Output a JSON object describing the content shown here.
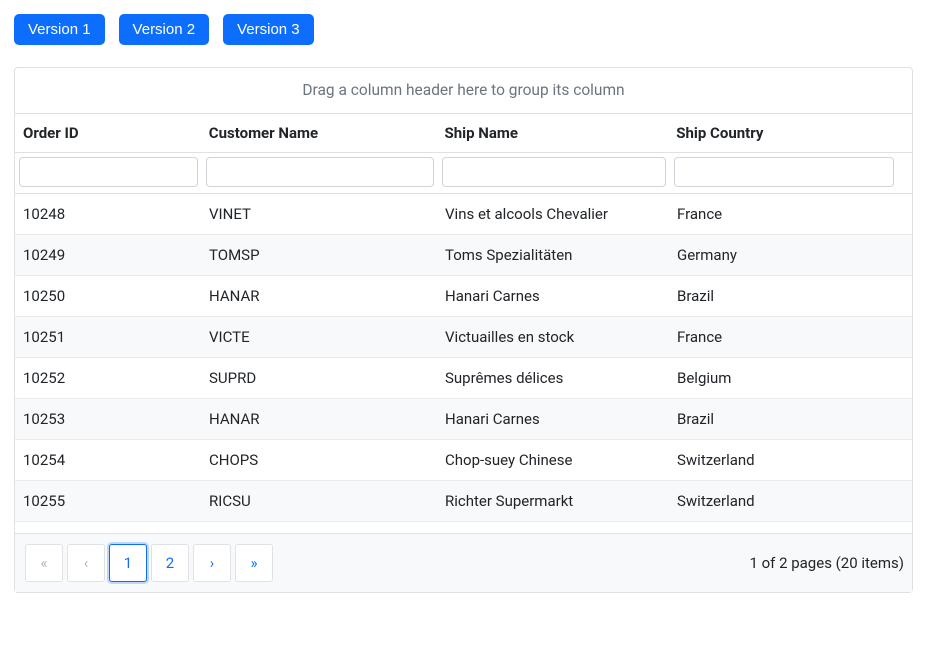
{
  "buttons": {
    "v1": "Version 1",
    "v2": "Version 2",
    "v3": "Version 3"
  },
  "grid": {
    "groupHint": "Drag a column header here to group its column",
    "columns": [
      {
        "label": "Order ID",
        "field": "orderId"
      },
      {
        "label": "Customer Name",
        "field": "customerName"
      },
      {
        "label": "Ship Name",
        "field": "shipName"
      },
      {
        "label": "Ship Country",
        "field": "shipCountry"
      }
    ],
    "filters": [
      "",
      "",
      "",
      ""
    ],
    "rows": [
      {
        "orderId": "10248",
        "customerName": "VINET",
        "shipName": "Vins et alcools Chevalier",
        "shipCountry": "France"
      },
      {
        "orderId": "10249",
        "customerName": "TOMSP",
        "shipName": "Toms Spezialitäten",
        "shipCountry": "Germany"
      },
      {
        "orderId": "10250",
        "customerName": "HANAR",
        "shipName": "Hanari Carnes",
        "shipCountry": "Brazil"
      },
      {
        "orderId": "10251",
        "customerName": "VICTE",
        "shipName": "Victuailles en stock",
        "shipCountry": "France"
      },
      {
        "orderId": "10252",
        "customerName": "SUPRD",
        "shipName": "Suprêmes délices",
        "shipCountry": "Belgium"
      },
      {
        "orderId": "10253",
        "customerName": "HANAR",
        "shipName": "Hanari Carnes",
        "shipCountry": "Brazil"
      },
      {
        "orderId": "10254",
        "customerName": "CHOPS",
        "shipName": "Chop-suey Chinese",
        "shipCountry": "Switzerland"
      },
      {
        "orderId": "10255",
        "customerName": "RICSU",
        "shipName": "Richter Supermarkt",
        "shipCountry": "Switzerland"
      }
    ]
  },
  "pager": {
    "first": "«",
    "prev": "‹",
    "next": "›",
    "last": "»",
    "pages": [
      "1",
      "2"
    ],
    "current": "1",
    "info": "1 of 2 pages (20 items)"
  }
}
